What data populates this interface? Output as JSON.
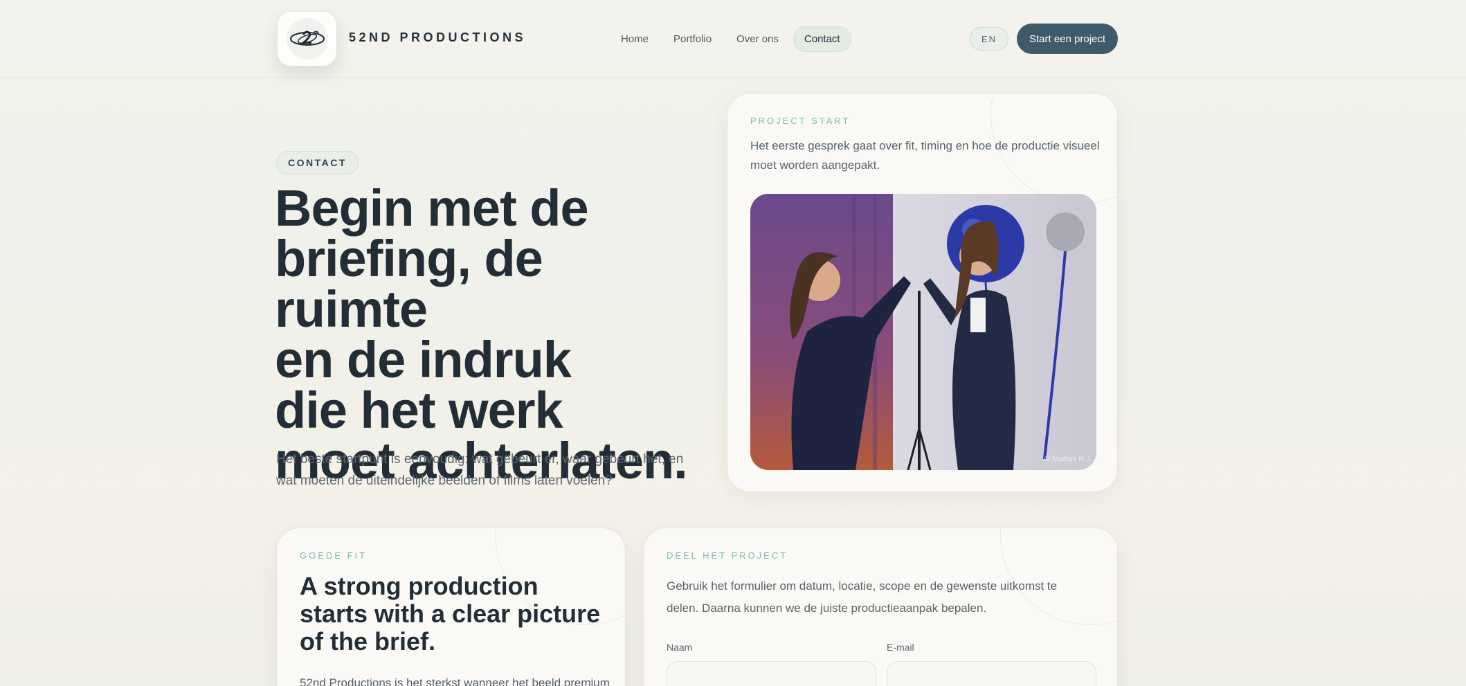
{
  "header": {
    "brand": "52ND PRODUCTIONS",
    "logo_icon": "brand-logo",
    "nav": [
      {
        "label": "Home",
        "active": false
      },
      {
        "label": "Portfolio",
        "active": false
      },
      {
        "label": "Over ons",
        "active": false
      },
      {
        "label": "Contact",
        "active": true
      }
    ],
    "language_label": "EN",
    "cta_label": "Start een project"
  },
  "hero": {
    "badge": "CONTACT",
    "headline_lines": [
      "Begin met de",
      "briefing, de ruimte",
      "en de indruk",
      "die het werk",
      "moet achterlaten."
    ],
    "lead": "Het beste startpunt is eenvoudig: wat gebeurt er, waar gebeurt het, en wat moeten de uiteindelijke beelden of films laten voelen?"
  },
  "project_start": {
    "eyebrow": "PROJECT START",
    "text": "Het eerste gesprek gaat over fit, timing en hoe de productie visueel moet worden aangepakt.",
    "photo_credit": "© Mathijs R.J."
  },
  "good_fit": {
    "eyebrow": "GOEDE FIT",
    "title": "A strong production starts with a clear picture of the brief.",
    "text": "52nd Productions is het sterkst wanneer het beeld premium"
  },
  "share_project": {
    "eyebrow": "DEEL HET PROJECT",
    "text": "Gebruik het formulier om datum, locatie, scope en de gewenste uitkomst te delen. Daarna kunnen we de juiste productieaanpak bepalen.",
    "name_label": "Naam",
    "email_label": "E-mail"
  },
  "colors": {
    "accent": "#3e5a6b",
    "eyebrow": "#7cbdb6",
    "heading": "#222d36"
  }
}
